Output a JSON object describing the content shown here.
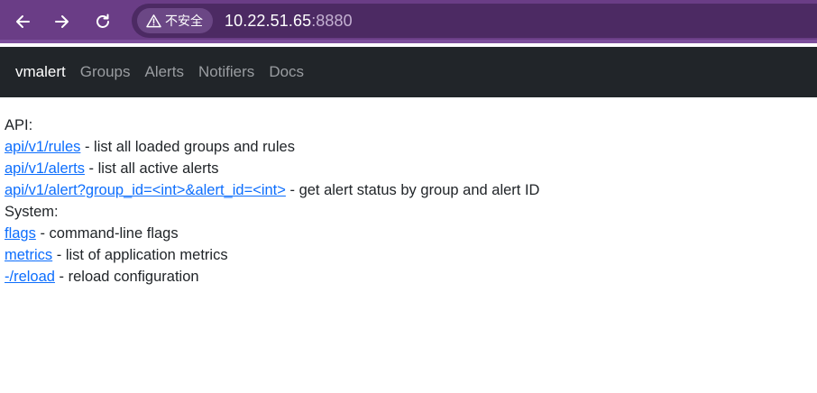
{
  "browser": {
    "security_label": "不安全",
    "url_host": "10.22.51.65",
    "url_port": ":8880",
    "colors": {
      "toolbar": "#6a3d86",
      "address_bar": "#4c2a63"
    },
    "icons": [
      "back-arrow-icon",
      "forward-arrow-icon",
      "reload-icon",
      "warning-icon"
    ]
  },
  "navbar": {
    "brand": "vmalert",
    "links": [
      "Groups",
      "Alerts",
      "Notifiers",
      "Docs"
    ]
  },
  "content": {
    "api_heading": "API:",
    "api_items": [
      {
        "link": "api/v1/rules",
        "desc": " - list all loaded groups and rules"
      },
      {
        "link": "api/v1/alerts",
        "desc": " - list all active alerts"
      },
      {
        "link": "api/v1/alert?group_id=<int>&alert_id=<int>",
        "desc": " - get alert status by group and alert ID"
      }
    ],
    "system_heading": "System:",
    "system_items": [
      {
        "link": "flags",
        "desc": " - command-line flags"
      },
      {
        "link": "metrics",
        "desc": " - list of application metrics"
      },
      {
        "link": "-/reload",
        "desc": " - reload configuration"
      }
    ]
  }
}
